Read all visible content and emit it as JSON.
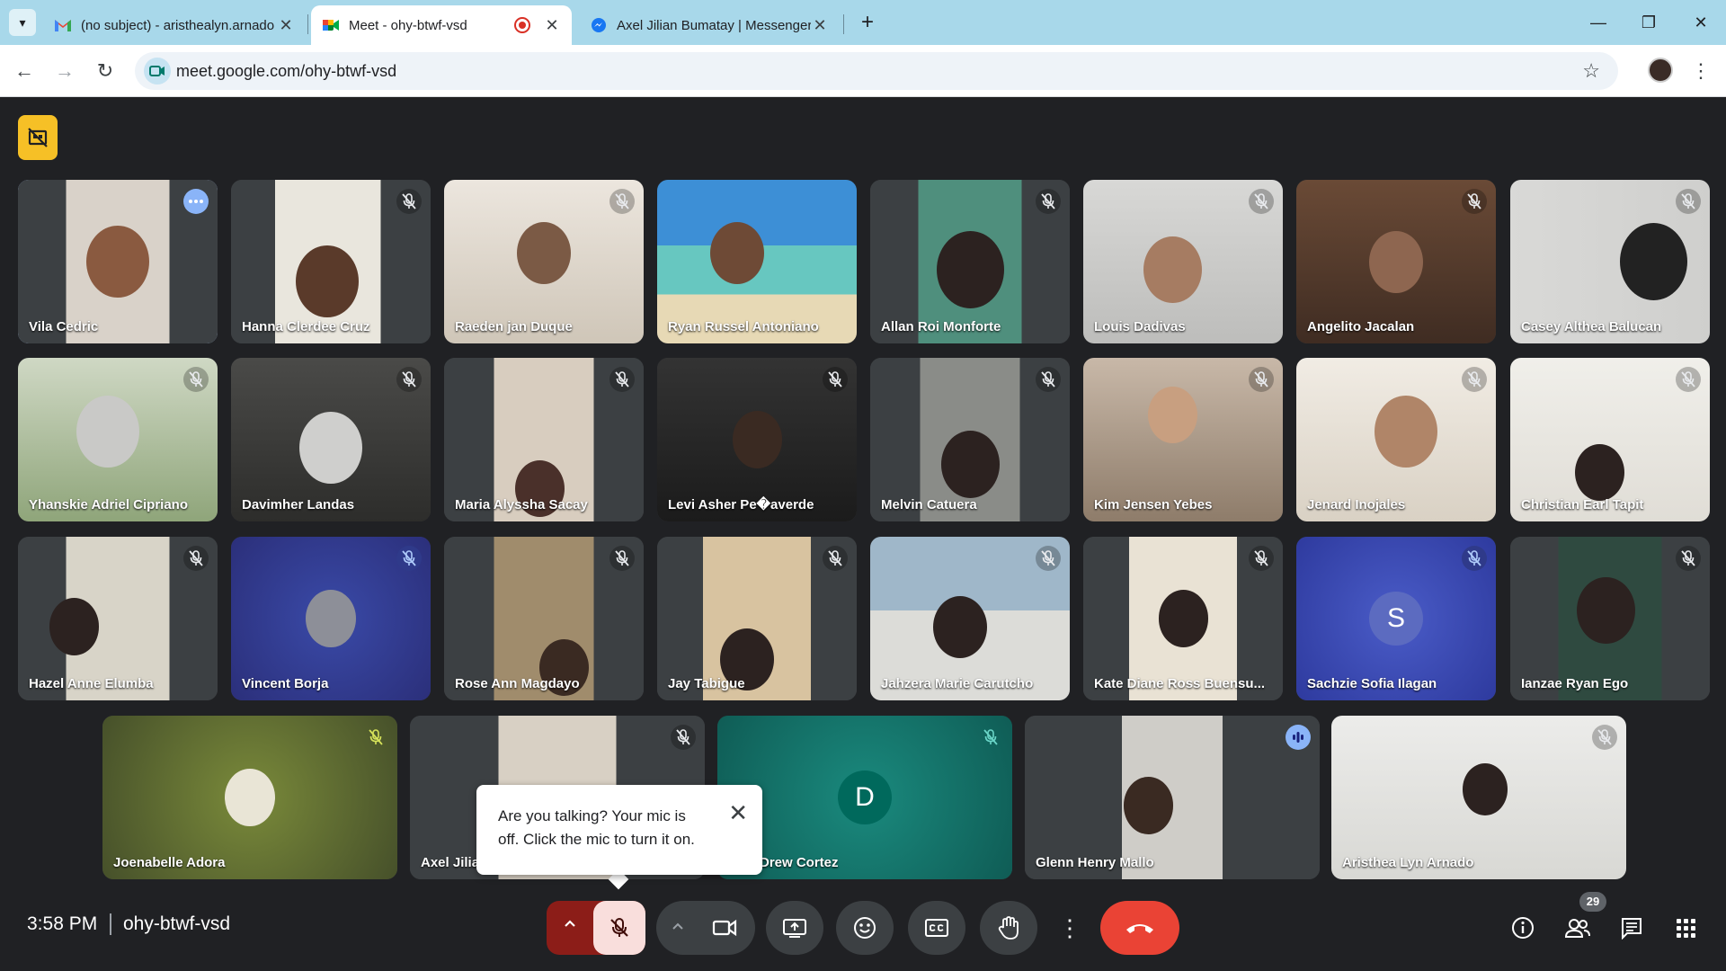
{
  "browser": {
    "tabs": [
      {
        "title": "(no subject) - aristhealyn.arnado",
        "favicon": "gmail-icon"
      },
      {
        "title": "Meet - ohy-btwf-vsd",
        "favicon": "meet-icon",
        "recording": true
      },
      {
        "title": "Axel Jilian Bumatay | Messenger",
        "favicon": "messenger-icon"
      }
    ],
    "url": "meet.google.com/ohy-btwf-vsd"
  },
  "participants": [
    {
      "name": "Vila Cedric",
      "state": "more-options"
    },
    {
      "name": "Hanna Clerdee Cruz",
      "state": "muted"
    },
    {
      "name": "Raeden jan Duque",
      "state": "muted"
    },
    {
      "name": "Ryan Russel Antoniano",
      "state": "none"
    },
    {
      "name": "Allan Roi Monforte",
      "state": "muted"
    },
    {
      "name": "Louis Dadivas",
      "state": "muted"
    },
    {
      "name": "Angelito Jacalan",
      "state": "muted"
    },
    {
      "name": "Casey Althea Balucan",
      "state": "muted"
    },
    {
      "name": "Yhanskie Adriel Cipriano",
      "state": "muted"
    },
    {
      "name": "Davimher Landas",
      "state": "muted"
    },
    {
      "name": "Maria Alyssha Sacay",
      "state": "muted"
    },
    {
      "name": "Levi Asher Pe�averde",
      "state": "muted"
    },
    {
      "name": "Melvin Catuera",
      "state": "muted"
    },
    {
      "name": "Kim Jensen Yebes",
      "state": "muted"
    },
    {
      "name": "Jenard Inojales",
      "state": "muted"
    },
    {
      "name": "Christian Earl Tapit",
      "state": "muted"
    },
    {
      "name": "Hazel Anne Elumba",
      "state": "muted"
    },
    {
      "name": "Vincent Borja",
      "state": "muted"
    },
    {
      "name": "Rose Ann Magdayo",
      "state": "muted"
    },
    {
      "name": "Jay Tabigue",
      "state": "muted"
    },
    {
      "name": "Jahzera Marie Carutcho",
      "state": "muted"
    },
    {
      "name": "Kate Diane Ross Buensu...",
      "state": "muted"
    },
    {
      "name": "Sachzie Sofia Ilagan",
      "state": "muted",
      "letter": "S"
    },
    {
      "name": "Ianzae Ryan Ego",
      "state": "muted"
    },
    {
      "name": "Joenabelle Adora",
      "state": "muted"
    },
    {
      "name": "Axel Jilia",
      "state": "muted"
    },
    {
      "name": "nuel Drew Cortez",
      "state": "muted",
      "letter": "D"
    },
    {
      "name": "Glenn Henry Mallo",
      "state": "speaking"
    },
    {
      "name": "Aristhea Lyn Arnado",
      "state": "muted"
    }
  ],
  "toast": {
    "message": "Are you talking? Your mic is off. Click the mic to turn it on."
  },
  "bottom_bar": {
    "time": "3:58 PM",
    "meeting_code": "ohy-btwf-vsd",
    "participant_count": "29"
  },
  "colors": {
    "accent_blue": "#8ab4f8",
    "mic_off_red": "#8c1d18",
    "hangup_red": "#ea4335",
    "badge_yellow": "#f6c026"
  }
}
